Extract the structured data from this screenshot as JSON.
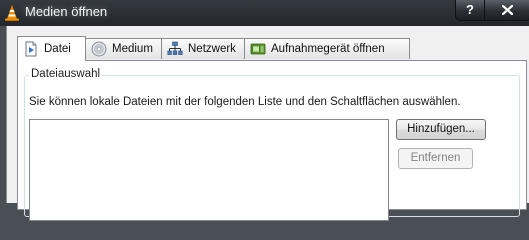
{
  "window": {
    "title": "Medien öffnen",
    "help_label": "?",
    "close_label": "X"
  },
  "tabs": [
    {
      "label": "Datei",
      "icon": "file-icon",
      "active": true
    },
    {
      "label": "Medium",
      "icon": "disc-icon",
      "active": false
    },
    {
      "label": "Netzwerk",
      "icon": "network-icon",
      "active": false
    },
    {
      "label": "Aufnahmegerät öffnen",
      "icon": "capture-device-icon",
      "active": false
    }
  ],
  "file_selection": {
    "group_title": "Dateiauswahl",
    "description": "Sie können lokale Dateien mit der folgenden Liste und den Schaltflächen auswählen.",
    "files": [],
    "add_button": "Hinzufügen...",
    "remove_button": "Entfernen",
    "remove_enabled": false
  },
  "colors": {
    "titlebar": "#2b2f34",
    "window_background": "#f0f0f0",
    "vlc_orange": "#f08a00"
  }
}
